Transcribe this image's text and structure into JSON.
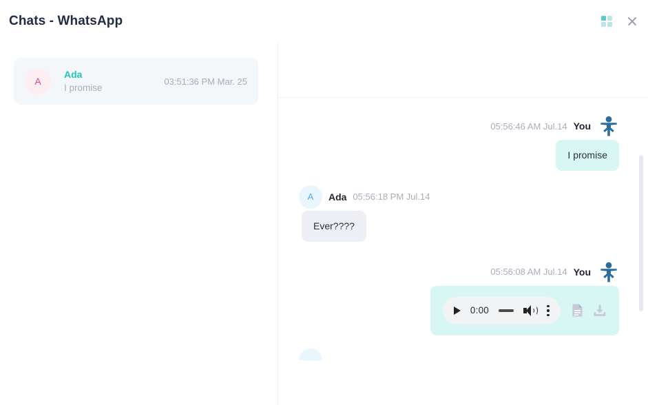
{
  "window": {
    "title": "Chats - WhatsApp",
    "grid_icon": "grid-apps-icon",
    "close_icon": "close-icon"
  },
  "sidebar": {
    "chats": [
      {
        "avatar_initial": "A",
        "name": "Ada",
        "preview": "I promise",
        "time": "03:51:36 PM Mar. 25",
        "selected": true
      }
    ]
  },
  "conversation": {
    "messages": [
      {
        "direction": "out",
        "sender": "You",
        "time": "05:56:46 AM Jul.14",
        "type": "text",
        "text": "I promise",
        "avatar_icon": "person-figure-icon"
      },
      {
        "direction": "in",
        "sender": "Ada",
        "time": "05:56:18 PM Jul.14",
        "type": "text",
        "text": "Ever????",
        "avatar_initial": "A"
      },
      {
        "direction": "out",
        "sender": "You",
        "time": "05:56:08 AM Jul.14",
        "type": "audio",
        "avatar_icon": "person-figure-icon",
        "player": {
          "current_time": "0:00",
          "play_icon": "play-icon",
          "volume_icon": "volume-icon",
          "menu_icon": "more-options-icon"
        },
        "attachments": {
          "file_icon": "document-icon",
          "download_icon": "download-icon"
        }
      }
    ]
  },
  "colors": {
    "accent_teal": "#20c5bd",
    "bubble_out": "#d7f6f4",
    "bubble_in": "#eeeef5",
    "avatar_you": "#2d6d9e",
    "title_text": "#252b42"
  }
}
